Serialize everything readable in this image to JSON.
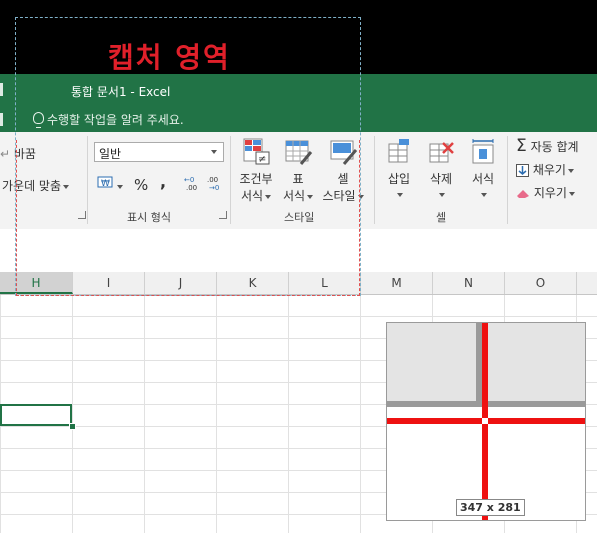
{
  "capture_label": "캡처 영역",
  "window_title": "통합 문서1 - Excel",
  "tell_me": "수행할 작업을 알려 주세요.",
  "ribbon": {
    "alignment": {
      "wrap_label": "바꿈",
      "merge_label": "가운데 맞춤"
    },
    "number": {
      "format_value": "일반",
      "percent_label": "%",
      "comma_label": ",",
      "group_label": "표시 형식"
    },
    "styles": {
      "conditional_label_1": "조건부",
      "conditional_label_2": "서식",
      "table_label_1": "표",
      "table_label_2": "서식",
      "cell_style_label_1": "셀",
      "cell_style_label_2": "스타일",
      "group_label": "스타일"
    },
    "cells": {
      "insert_label": "삽입",
      "delete_label": "삭제",
      "format_label": "서식",
      "group_label": "셀"
    },
    "editing": {
      "autosum_label": "자동 합계",
      "fill_label": "채우기",
      "clear_label": "지우기"
    }
  },
  "columns": [
    "H",
    "I",
    "J",
    "K",
    "L",
    "M",
    "N",
    "O"
  ],
  "active_column": "H",
  "magnifier": {
    "readout": "347 x 281"
  },
  "colors": {
    "excel_green": "#217346",
    "capture_red": "#e0202a",
    "crosshair_red": "#ee1111"
  }
}
